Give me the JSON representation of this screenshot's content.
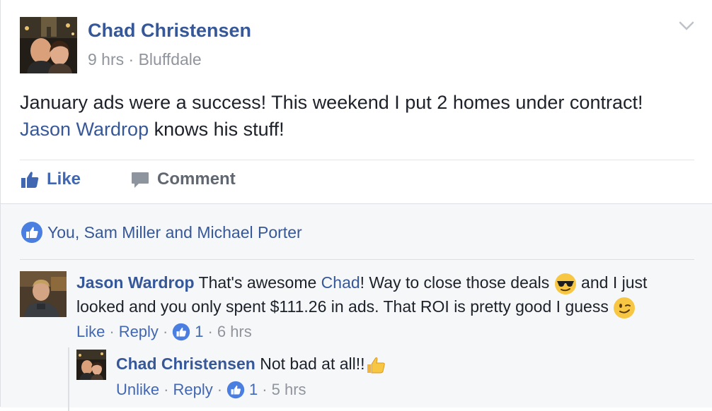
{
  "post": {
    "author": "Chad Christensen",
    "time": "9 hrs",
    "separator": " · ",
    "location": "Bluffdale",
    "text_part1": "January ads were a success! This weekend I put 2 homes under contract!",
    "text_link": "Jason Wardrop",
    "text_part2": " knows his stuff!"
  },
  "actions": {
    "like_label": "Like",
    "comment_label": "Comment"
  },
  "likes_summary": "You, Sam Miller and Michael Porter",
  "comments": [
    {
      "author": "Jason Wardrop",
      "text_a": " That's awesome ",
      "mention": "Chad",
      "text_b": "! Way to close those deals ",
      "text_c": " and I just looked and you only spent $111.26 in ads. That ROI is pretty good I guess ",
      "like_label": "Like",
      "reply_label": "Reply",
      "like_count": "1",
      "time": "6 hrs"
    }
  ],
  "reply": {
    "author": "Chad Christensen",
    "text": " Not bad at all!!",
    "unlike_label": "Unlike",
    "reply_label": "Reply",
    "like_count": "1",
    "time": "5 hrs"
  },
  "colors": {
    "link": "#365899",
    "action_blue": "#4267b2",
    "meta_gray": "#90949c",
    "feedback_bg": "#f6f7f9"
  },
  "icons": {
    "post_menu": "chevron-down-icon",
    "like": "thumbs-up-icon",
    "comment": "speech-bubble-icon",
    "like_badge": "like-badge-icon",
    "emoji_sunglasses": "sunglasses-emoji",
    "emoji_wink": "wink-emoji",
    "emoji_thumb": "thumbs-up-emoji"
  }
}
